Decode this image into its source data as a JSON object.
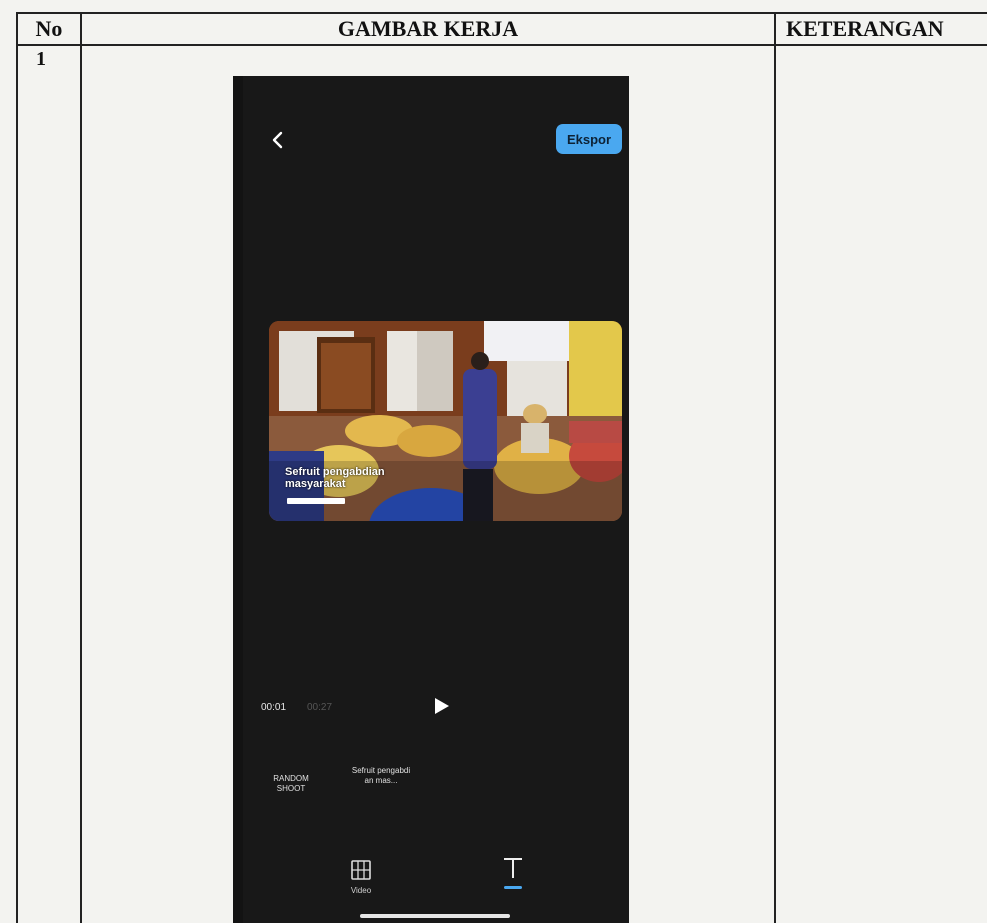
{
  "table": {
    "headers": [
      "No",
      "GAMBAR KERJA",
      "KETERANGAN"
    ],
    "row_number": "1"
  },
  "app": {
    "export_label": "Ekspor",
    "caption_text": "Sefruit pengabdian masyarakat",
    "time_current": "00:01",
    "time_total": "00:27",
    "clips": [
      "RANDOM SHOOT",
      "Sefruit pengabdi an mas..."
    ],
    "tools": [
      "Video"
    ],
    "icons": [
      "back-chevron-icon",
      "play-icon",
      "film-icon",
      "text-tool-icon"
    ],
    "accent": "#4aa8f0"
  }
}
